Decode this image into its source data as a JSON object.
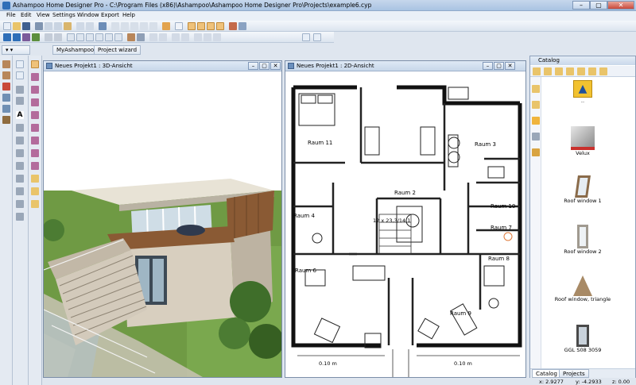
{
  "window": {
    "title": "Ashampoo Home Designer Pro - C:\\Program Files (x86)\\Ashampoo\\Ashampoo Home Designer Pro\\Projects\\example6.cyp",
    "minimize": "–",
    "maximize": "▢",
    "close": "✕"
  },
  "menu": {
    "items": [
      "File",
      "Edit",
      "View",
      "Settings",
      "Window",
      "Export",
      "Help"
    ]
  },
  "tabs": {
    "myashampoo": "MyAshampoo",
    "wizard": "Project wizard"
  },
  "view3d": {
    "title": "Neues Projekt1 : 3D-Ansicht"
  },
  "view2d": {
    "title": "Neues Projekt1 : 2D-Ansicht",
    "rooms": [
      "Raum 11",
      "Raum 2",
      "Raum 3",
      "Raum 10",
      "Raum 7",
      "Raum 4",
      "Raum 8",
      "Raum 6",
      "Raum 9"
    ],
    "dimension": "12 x 23,3/14,1",
    "measure_left": "0.10 m",
    "measure_right": "0.10 m"
  },
  "catalog": {
    "title": "Catalog",
    "items": [
      "..",
      "Velux",
      "Roof window 1",
      "Roof window 2",
      "Roof window, triangle",
      "GGL S08 3059"
    ],
    "tab_catalog": "Catalog",
    "tab_projects": "Projects"
  },
  "status": {
    "x": "x: 2.9277",
    "y": "y: -4.2933",
    "z": "z: 0.00"
  },
  "colors": {
    "accent": "#2f6fb8",
    "sky": "#ffffff",
    "grass": "#5c8a3a",
    "pool": "#3fa7d6",
    "wood": "#8a5a34",
    "wall": "#d8cfbf"
  }
}
